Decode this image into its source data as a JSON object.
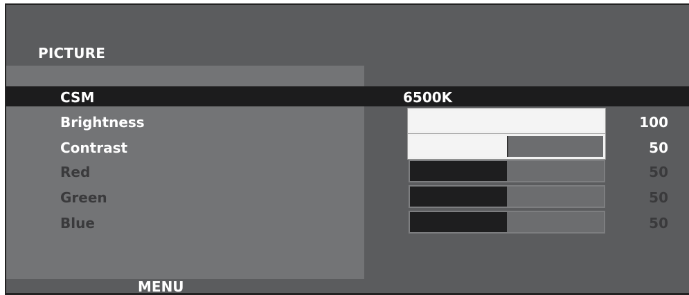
{
  "osd": {
    "title": "PICTURE",
    "csm": {
      "label": "CSM",
      "value": "6500K"
    },
    "rows": [
      {
        "label": "Brightness",
        "value": "100",
        "level": 1.0,
        "state": "active"
      },
      {
        "label": "Contrast",
        "value": "50",
        "level": 0.5,
        "state": "active"
      },
      {
        "label": "Red",
        "value": "50",
        "level": 0.5,
        "state": "dim"
      },
      {
        "label": "Green",
        "value": "50",
        "level": 0.5,
        "state": "dim"
      },
      {
        "label": "Blue",
        "value": "50",
        "level": 0.5,
        "state": "dim"
      }
    ],
    "menu_label": "MENU",
    "colors": {
      "background": "#5b5c5e",
      "panel": "#737476",
      "selection": "#1c1c1d",
      "active_text": "#ffffff",
      "dim_text": "#3a3a3c"
    }
  }
}
